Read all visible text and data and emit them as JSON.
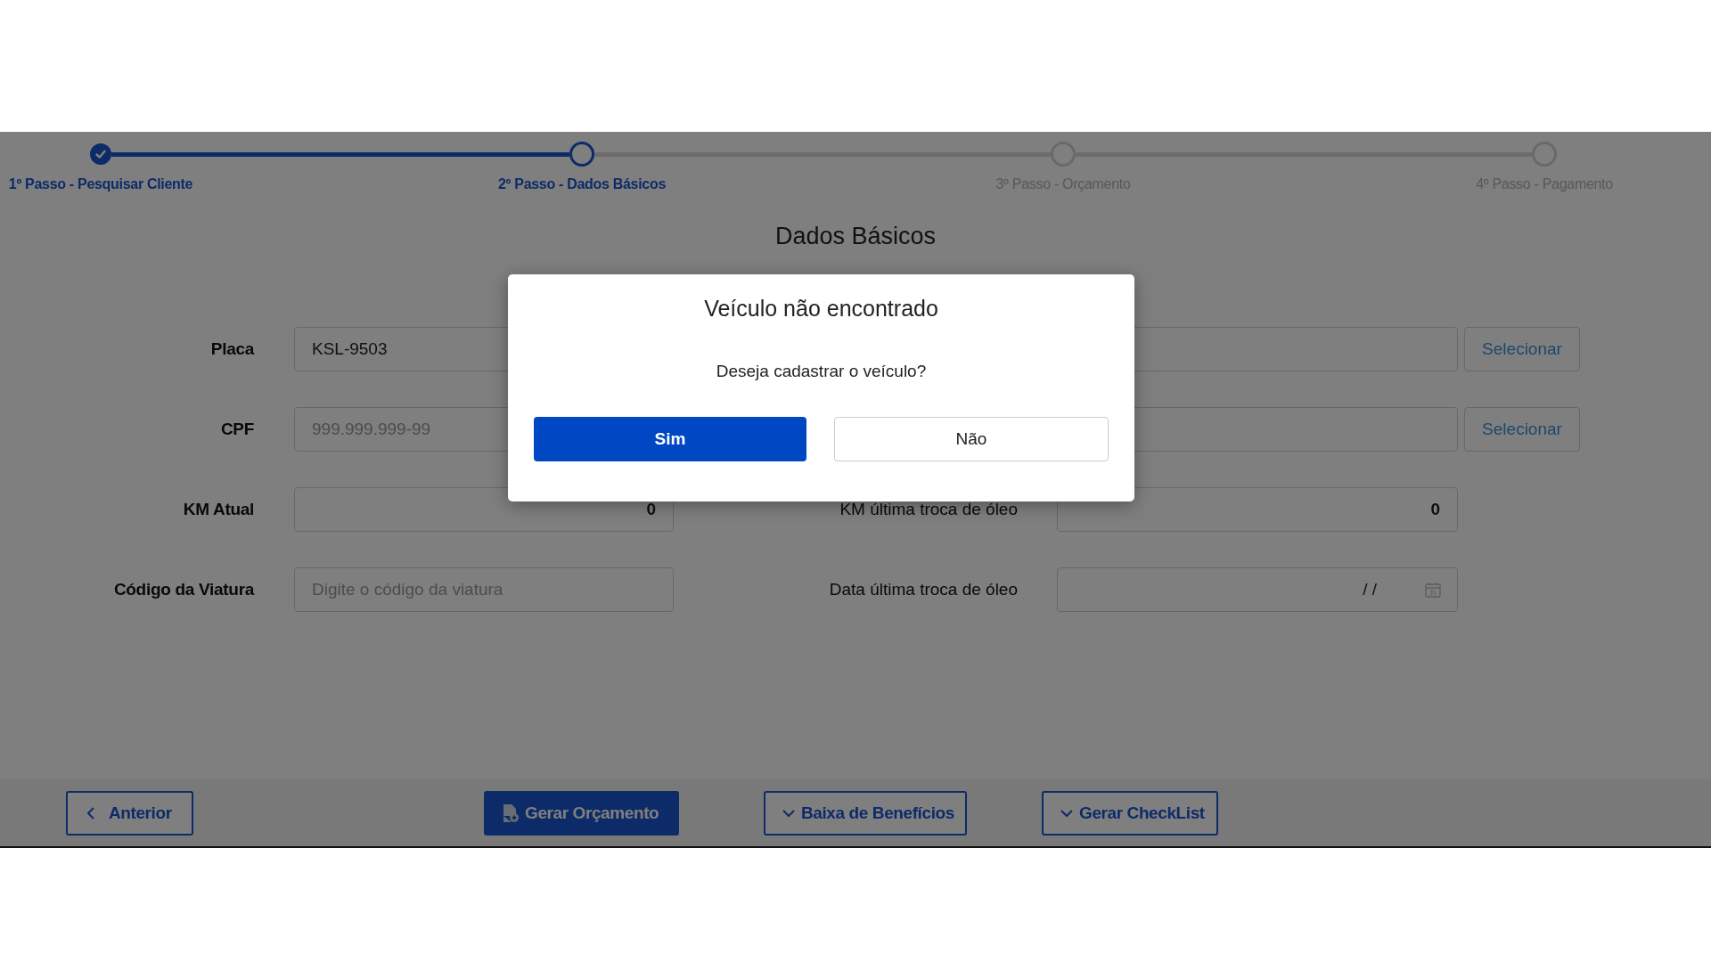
{
  "stepper": [
    {
      "label": "1º Passo - Pesquisar Cliente",
      "completed": true,
      "selected": false
    },
    {
      "label": "2º Passo - Dados Básicos",
      "completed": false,
      "selected": true
    },
    {
      "label": "3º Passo - Orçamento",
      "completed": false,
      "selected": false
    },
    {
      "label": "4º Passo - Pagamento",
      "completed": false,
      "selected": false
    }
  ],
  "page_title": "Dados Básicos",
  "form_rows": [
    {
      "label": "Placa",
      "field": {
        "kind": "text",
        "value": "KSL-9503"
      },
      "right_field": {
        "kind": "text"
      },
      "right_button": "Selecionar"
    },
    {
      "label": "CPF",
      "field": {
        "kind": "text",
        "placeholder": "999.999.999-99"
      },
      "right_field": {
        "kind": "text"
      },
      "right_button": "Selecionar"
    },
    {
      "label": "KM Atual",
      "field": {
        "kind": "number",
        "value": "0"
      },
      "right_label": "KM última troca de óleo",
      "right_field": {
        "kind": "number",
        "value": "0"
      }
    },
    {
      "label": "Código da Viatura",
      "field": {
        "kind": "text",
        "placeholder": "Digite o código da viatura"
      },
      "right_label": "Data última troca de óleo",
      "right_field": {
        "kind": "date",
        "value": "/ /"
      }
    }
  ],
  "footer_buttons": [
    {
      "label": "Anterior",
      "kind": "back"
    },
    {
      "label": "Gerar Orçamento",
      "kind": "primary"
    },
    {
      "label": "Baixa de Benefícios",
      "kind": "dropdown"
    },
    {
      "label": "Gerar CheckList",
      "kind": "dropdown"
    }
  ],
  "dialog": {
    "title": "Veículo não encontrado",
    "message": "Deseja cadastrar o veículo?",
    "buttons": [
      {
        "label": "Sim",
        "kind": "primary"
      },
      {
        "label": "Não",
        "kind": "secondary"
      }
    ]
  }
}
